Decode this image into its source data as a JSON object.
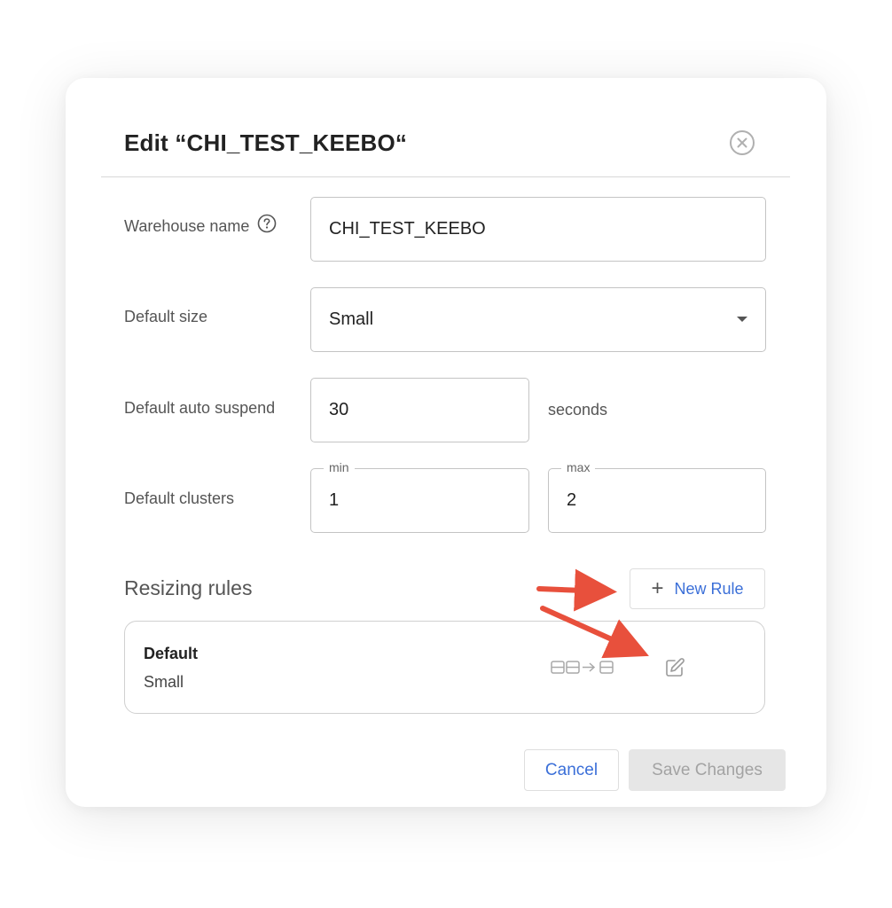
{
  "dialog": {
    "title": "Edit “CHI_TEST_KEEBO“",
    "close_icon": "close-circle-icon"
  },
  "form": {
    "warehouse_name": {
      "label": "Warehouse name",
      "value": "CHI_TEST_KEEBO",
      "help_icon": "question-circle-icon"
    },
    "default_size": {
      "label": "Default size",
      "value": "Small"
    },
    "auto_suspend": {
      "label": "Default auto suspend",
      "value": "30",
      "units": "seconds"
    },
    "clusters": {
      "label": "Default clusters",
      "min_label": "min",
      "min_value": "1",
      "max_label": "max",
      "max_value": "2"
    }
  },
  "resizing_rules": {
    "title": "Resizing rules",
    "new_rule_label": "New Rule",
    "rules": [
      {
        "name": "Default",
        "size": "Small",
        "icon": "resize-warehouse-icon",
        "edit_icon": "edit-icon"
      }
    ]
  },
  "footer": {
    "cancel_label": "Cancel",
    "save_label": "Save Changes"
  },
  "colors": {
    "accent": "#3b6fd8",
    "annotation_arrow": "#e8503c",
    "disabled_bg": "#e6e6e6",
    "disabled_text": "#a3a3a3"
  }
}
